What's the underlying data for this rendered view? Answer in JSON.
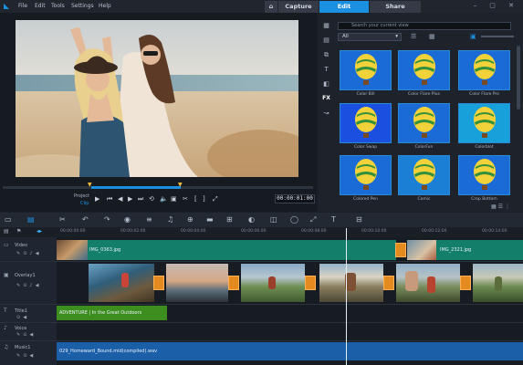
{
  "menu": {
    "items": [
      "File",
      "Edit",
      "Tools",
      "Settings",
      "Help"
    ],
    "tabs": [
      {
        "label": "Capture",
        "active": false
      },
      {
        "label": "Edit",
        "active": true
      },
      {
        "label": "Share",
        "active": false
      }
    ]
  },
  "player": {
    "project_label": "Project",
    "clip_label": "Clip",
    "timecode": "00:00:01:00",
    "progress_fraction": 0.29
  },
  "library": {
    "search_placeholder": "Search your current view",
    "dropdown_value": "All",
    "items": [
      {
        "label": "Color Bill"
      },
      {
        "label": "Color Flare Plus"
      },
      {
        "label": "Color Flare Pro"
      },
      {
        "label": "Color Swap"
      },
      {
        "label": "ColorFun"
      },
      {
        "label": "Colorblot"
      },
      {
        "label": "Colored Pen"
      },
      {
        "label": "Comic"
      },
      {
        "label": "Crop Bottom"
      }
    ]
  },
  "timeline": {
    "ruler_ticks": [
      "00:00:00:00",
      "00:00:02:00",
      "00:00:04:00",
      "00:00:06:00",
      "00:00:08:00",
      "00:00:10:00",
      "00:00:12:00",
      "00:00:14:00"
    ],
    "tracks": [
      {
        "name": "Video"
      },
      {
        "name": "Overlay1"
      },
      {
        "name": "Title1"
      },
      {
        "name": "Voice"
      },
      {
        "name": "Music1"
      }
    ],
    "video_clips": [
      {
        "label": "IMG_0363.jpg"
      },
      {
        "label": "IMG_2321.jpg"
      }
    ],
    "title_clip": "ADVENTURE | In the Great Outdoors",
    "music_clip": "029_Homeward_Bound.mid(compiled).wav"
  },
  "colors": {
    "accent": "#1b8fe0",
    "video_clip": "#137f6b",
    "title_clip": "#3c8f1f",
    "music_clip": "#1a5fa8",
    "transition": "#e58a1f"
  }
}
